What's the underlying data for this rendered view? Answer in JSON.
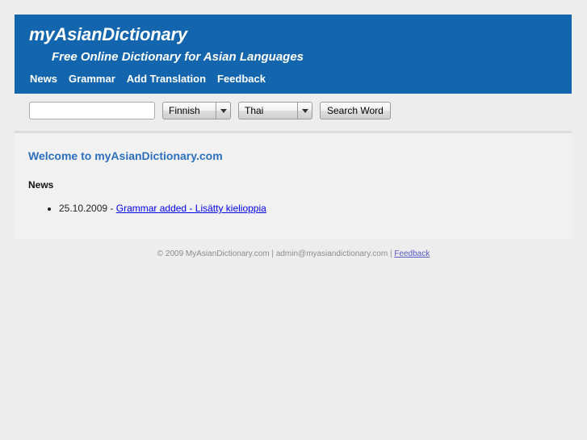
{
  "header": {
    "site_title": "myAsianDictionary",
    "tagline": "Free Online Dictionary for Asian Languages",
    "accent_color": "#1366ad",
    "nav": [
      {
        "label": "News"
      },
      {
        "label": "Grammar"
      },
      {
        "label": "Add Translation"
      },
      {
        "label": "Feedback"
      }
    ]
  },
  "search": {
    "value": "",
    "placeholder": "",
    "source_language": {
      "selected": "Finnish",
      "arrow_icon": "chevron-down-icon"
    },
    "target_language": {
      "selected": "Thai",
      "arrow_icon": "chevron-down-icon"
    },
    "submit_label": "Search Word"
  },
  "main": {
    "welcome_heading": "Welcome to myAsianDictionary.com",
    "welcome_heading_color": "#2c6fbd",
    "news_heading": "News",
    "news_items": [
      {
        "date": "25.10.2009 - ",
        "link_text": "Grammar added - Lisätty kielioppia",
        "link_color": "#0000ee"
      }
    ]
  },
  "footer": {
    "copyright": "© 2009 MyAsianDictionary.com",
    "separator_1": " | ",
    "email": "admin@myasiandictionary.com",
    "separator_2": " | ",
    "feedback_label": "Feedback"
  }
}
